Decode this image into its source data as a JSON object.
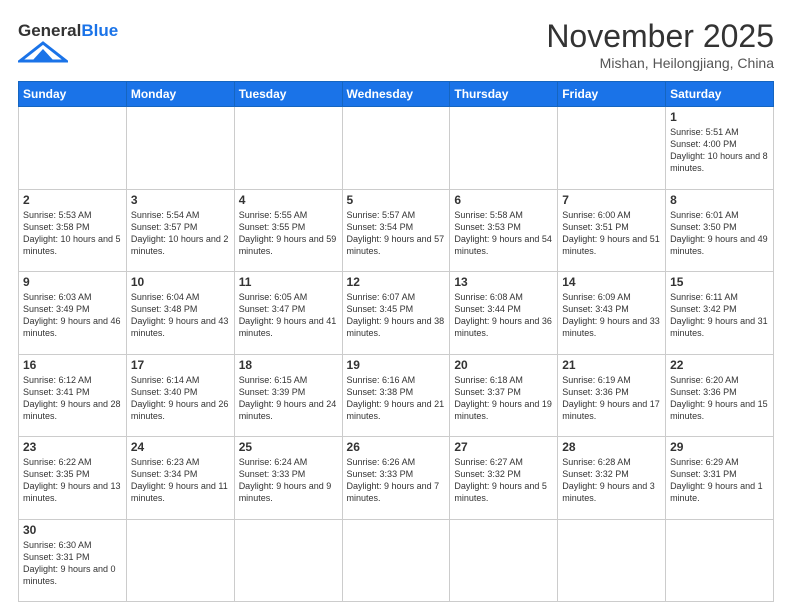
{
  "header": {
    "logo_general": "General",
    "logo_blue": "Blue",
    "month_title": "November 2025",
    "location": "Mishan, Heilongjiang, China"
  },
  "weekdays": [
    "Sunday",
    "Monday",
    "Tuesday",
    "Wednesday",
    "Thursday",
    "Friday",
    "Saturday"
  ],
  "weeks": [
    [
      {
        "day": "",
        "info": ""
      },
      {
        "day": "",
        "info": ""
      },
      {
        "day": "",
        "info": ""
      },
      {
        "day": "",
        "info": ""
      },
      {
        "day": "",
        "info": ""
      },
      {
        "day": "",
        "info": ""
      },
      {
        "day": "1",
        "info": "Sunrise: 5:51 AM\nSunset: 4:00 PM\nDaylight: 10 hours\nand 8 minutes."
      }
    ],
    [
      {
        "day": "2",
        "info": "Sunrise: 5:53 AM\nSunset: 3:58 PM\nDaylight: 10 hours\nand 5 minutes."
      },
      {
        "day": "3",
        "info": "Sunrise: 5:54 AM\nSunset: 3:57 PM\nDaylight: 10 hours\nand 2 minutes."
      },
      {
        "day": "4",
        "info": "Sunrise: 5:55 AM\nSunset: 3:55 PM\nDaylight: 9 hours\nand 59 minutes."
      },
      {
        "day": "5",
        "info": "Sunrise: 5:57 AM\nSunset: 3:54 PM\nDaylight: 9 hours\nand 57 minutes."
      },
      {
        "day": "6",
        "info": "Sunrise: 5:58 AM\nSunset: 3:53 PM\nDaylight: 9 hours\nand 54 minutes."
      },
      {
        "day": "7",
        "info": "Sunrise: 6:00 AM\nSunset: 3:51 PM\nDaylight: 9 hours\nand 51 minutes."
      },
      {
        "day": "8",
        "info": "Sunrise: 6:01 AM\nSunset: 3:50 PM\nDaylight: 9 hours\nand 49 minutes."
      }
    ],
    [
      {
        "day": "9",
        "info": "Sunrise: 6:03 AM\nSunset: 3:49 PM\nDaylight: 9 hours\nand 46 minutes."
      },
      {
        "day": "10",
        "info": "Sunrise: 6:04 AM\nSunset: 3:48 PM\nDaylight: 9 hours\nand 43 minutes."
      },
      {
        "day": "11",
        "info": "Sunrise: 6:05 AM\nSunset: 3:47 PM\nDaylight: 9 hours\nand 41 minutes."
      },
      {
        "day": "12",
        "info": "Sunrise: 6:07 AM\nSunset: 3:45 PM\nDaylight: 9 hours\nand 38 minutes."
      },
      {
        "day": "13",
        "info": "Sunrise: 6:08 AM\nSunset: 3:44 PM\nDaylight: 9 hours\nand 36 minutes."
      },
      {
        "day": "14",
        "info": "Sunrise: 6:09 AM\nSunset: 3:43 PM\nDaylight: 9 hours\nand 33 minutes."
      },
      {
        "day": "15",
        "info": "Sunrise: 6:11 AM\nSunset: 3:42 PM\nDaylight: 9 hours\nand 31 minutes."
      }
    ],
    [
      {
        "day": "16",
        "info": "Sunrise: 6:12 AM\nSunset: 3:41 PM\nDaylight: 9 hours\nand 28 minutes."
      },
      {
        "day": "17",
        "info": "Sunrise: 6:14 AM\nSunset: 3:40 PM\nDaylight: 9 hours\nand 26 minutes."
      },
      {
        "day": "18",
        "info": "Sunrise: 6:15 AM\nSunset: 3:39 PM\nDaylight: 9 hours\nand 24 minutes."
      },
      {
        "day": "19",
        "info": "Sunrise: 6:16 AM\nSunset: 3:38 PM\nDaylight: 9 hours\nand 21 minutes."
      },
      {
        "day": "20",
        "info": "Sunrise: 6:18 AM\nSunset: 3:37 PM\nDaylight: 9 hours\nand 19 minutes."
      },
      {
        "day": "21",
        "info": "Sunrise: 6:19 AM\nSunset: 3:36 PM\nDaylight: 9 hours\nand 17 minutes."
      },
      {
        "day": "22",
        "info": "Sunrise: 6:20 AM\nSunset: 3:36 PM\nDaylight: 9 hours\nand 15 minutes."
      }
    ],
    [
      {
        "day": "23",
        "info": "Sunrise: 6:22 AM\nSunset: 3:35 PM\nDaylight: 9 hours\nand 13 minutes."
      },
      {
        "day": "24",
        "info": "Sunrise: 6:23 AM\nSunset: 3:34 PM\nDaylight: 9 hours\nand 11 minutes."
      },
      {
        "day": "25",
        "info": "Sunrise: 6:24 AM\nSunset: 3:33 PM\nDaylight: 9 hours\nand 9 minutes."
      },
      {
        "day": "26",
        "info": "Sunrise: 6:26 AM\nSunset: 3:33 PM\nDaylight: 9 hours\nand 7 minutes."
      },
      {
        "day": "27",
        "info": "Sunrise: 6:27 AM\nSunset: 3:32 PM\nDaylight: 9 hours\nand 5 minutes."
      },
      {
        "day": "28",
        "info": "Sunrise: 6:28 AM\nSunset: 3:32 PM\nDaylight: 9 hours\nand 3 minutes."
      },
      {
        "day": "29",
        "info": "Sunrise: 6:29 AM\nSunset: 3:31 PM\nDaylight: 9 hours\nand 1 minute."
      }
    ],
    [
      {
        "day": "30",
        "info": "Sunrise: 6:30 AM\nSunset: 3:31 PM\nDaylight: 9 hours\nand 0 minutes."
      },
      {
        "day": "",
        "info": ""
      },
      {
        "day": "",
        "info": ""
      },
      {
        "day": "",
        "info": ""
      },
      {
        "day": "",
        "info": ""
      },
      {
        "day": "",
        "info": ""
      },
      {
        "day": "",
        "info": ""
      }
    ]
  ]
}
